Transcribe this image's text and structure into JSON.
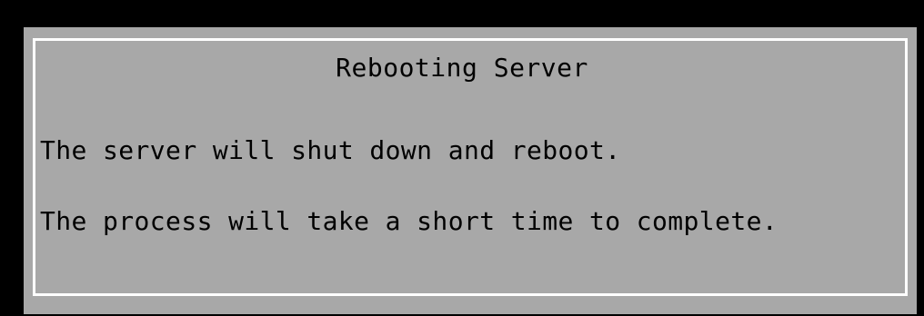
{
  "dialog": {
    "title": "Rebooting Server",
    "lines": [
      "The server will shut down and reboot.",
      "The process will take a short time to complete."
    ]
  },
  "colors": {
    "screen_background": "#000000",
    "dialog_background": "#a8a8a8",
    "dialog_border": "#ffffff",
    "text": "#000000"
  }
}
